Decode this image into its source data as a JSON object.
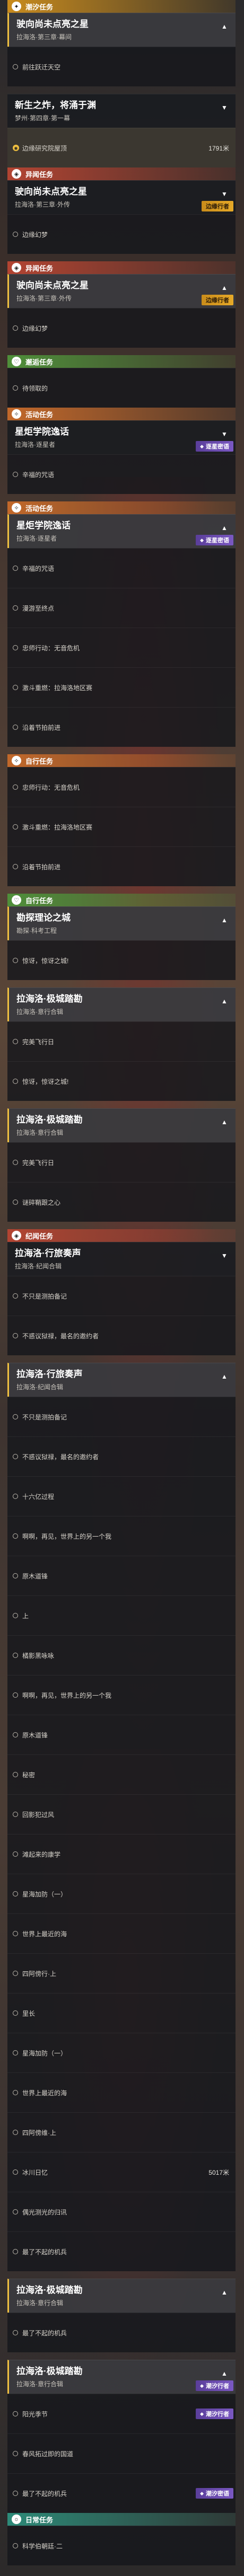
{
  "theme": {
    "trail": "#c88b1e",
    "rift": "#b34432",
    "event": "#c2682a",
    "companion": "#4f8f3a",
    "daily": "#2d8a78",
    "badge_gold": "#e6a928",
    "badge_purple": "#7a58c2"
  },
  "blocks": [
    {
      "type": "category",
      "style": "trail",
      "icon": "trail-icon",
      "label": "潮汐任务"
    },
    {
      "type": "quest",
      "title": "驶向尚未点亮之星",
      "sub": "拉海洛·第三章·幕间",
      "state": "expanded"
    },
    {
      "type": "objective",
      "text": "前往跃迁天空"
    },
    {
      "type": "spacer"
    },
    {
      "type": "quest",
      "title": "新生之炸，将涌于渊",
      "sub": "梦州·第四章·第一幕",
      "state": "collapsed"
    },
    {
      "type": "objective",
      "text": "边缘研究院屋顶",
      "dist": "1791米",
      "marker": "loc",
      "highlight": true
    },
    {
      "type": "category",
      "style": "rift",
      "icon": "rift-icon",
      "label": "异闻任务"
    },
    {
      "type": "quest",
      "title": "驶向尚未点亮之星",
      "sub": "拉海洛·第三章·外传",
      "badge": "边缘行者",
      "state": "collapsed"
    },
    {
      "type": "objective",
      "text": "边缘幻梦"
    },
    {
      "type": "spacer"
    },
    {
      "type": "category",
      "style": "rift",
      "icon": "rift-icon",
      "label": "异闻任务"
    },
    {
      "type": "quest",
      "title": "驶向尚未点亮之星",
      "sub": "拉海洛·第三章·外传",
      "badge": "边缘行者",
      "state": "expanded"
    },
    {
      "type": "objective",
      "text": "边缘幻梦"
    },
    {
      "type": "spacer"
    },
    {
      "type": "category",
      "style": "companion",
      "icon": "companion-icon",
      "label": "邂逅任务"
    },
    {
      "type": "objective",
      "text": "待领取的"
    },
    {
      "type": "category",
      "style": "event",
      "icon": "event-icon",
      "label": "活动任务"
    },
    {
      "type": "quest",
      "title": "星炬学院逸话",
      "sub": "拉海洛·逐星者",
      "badge": "逐星密语",
      "badge_style": "purple",
      "state": "collapsed"
    },
    {
      "type": "objective",
      "text": "辛福的咒语"
    },
    {
      "type": "spacer"
    },
    {
      "type": "category",
      "style": "event",
      "icon": "event-icon",
      "label": "活动任务"
    },
    {
      "type": "quest",
      "title": "星炬学院逸话",
      "sub": "拉海洛·逐星者",
      "badge": "逐星密语",
      "badge_style": "purple",
      "state": "expanded"
    },
    {
      "type": "objective",
      "text": "辛福的咒语"
    },
    {
      "type": "objective",
      "text": "漫游至终点"
    },
    {
      "type": "objective",
      "text": "忠师行动：无音危机"
    },
    {
      "type": "objective",
      "text": "激斗重燃：拉海洛地区赛"
    },
    {
      "type": "objective",
      "text": "沿着节拍前进"
    },
    {
      "type": "spacer"
    },
    {
      "type": "category",
      "style": "event",
      "icon": "event-icon",
      "label": "自行任务"
    },
    {
      "type": "objective",
      "text": "忠师行动：无音危机"
    },
    {
      "type": "objective",
      "text": "激斗重燃：拉海洛地区赛"
    },
    {
      "type": "objective",
      "text": "沿着节拍前进"
    },
    {
      "type": "spacer"
    },
    {
      "type": "category",
      "style": "companion",
      "icon": "companion-icon",
      "label": "自行任务"
    },
    {
      "type": "quest",
      "title": "勘探理论之城",
      "sub": "勘探·科考工程",
      "state": "expanded"
    },
    {
      "type": "objective",
      "text": "惊讶，惊讶之城!"
    },
    {
      "type": "spacer"
    },
    {
      "type": "quest",
      "title": "拉海洛·极城踏勘",
      "sub": "拉海洛·意行合辑",
      "state": "expanded"
    },
    {
      "type": "objective",
      "text": "完美飞行日"
    },
    {
      "type": "objective",
      "text": "惊讶，惊讶之城!"
    },
    {
      "type": "spacer"
    },
    {
      "type": "quest",
      "title": "拉海洛·极城踏勘",
      "sub": "拉海洛·意行合辑",
      "state": "expanded"
    },
    {
      "type": "objective",
      "text": "完美飞行日"
    },
    {
      "type": "objective",
      "text": "谜碎鞘跟之心"
    },
    {
      "type": "spacer"
    },
    {
      "type": "category",
      "style": "rift",
      "icon": "rift-icon",
      "label": "纪闻任务"
    },
    {
      "type": "quest",
      "title": "拉海洛·行旅奏声",
      "sub": "拉海洛·纪闻合辑",
      "state": "collapsed"
    },
    {
      "type": "objective",
      "text": "不只是测拍备记"
    },
    {
      "type": "objective",
      "text": "不惑议狱禄，最名的邀约者"
    },
    {
      "type": "spacer"
    },
    {
      "type": "quest",
      "title": "拉海洛·行旅奏声",
      "sub": "拉海洛·纪闻合辑",
      "state": "expanded"
    },
    {
      "type": "objective",
      "text": "不只是测拍备记"
    },
    {
      "type": "objective",
      "text": "不惑议狱禄，最名的邀约者"
    },
    {
      "type": "objective",
      "text": "十六亿过程"
    },
    {
      "type": "objective",
      "text": "啊啊，再见，世界上的另一个我"
    },
    {
      "type": "objective",
      "text": "原木道锋"
    },
    {
      "type": "objective",
      "text": "上"
    },
    {
      "type": "objective",
      "text": "橘影黑咏咏"
    },
    {
      "type": "objective",
      "text": "啊啊，再见，世界上的另一个我"
    },
    {
      "type": "objective",
      "text": "原木道锋"
    },
    {
      "type": "objective",
      "text": "秘密"
    },
    {
      "type": "objective",
      "text": "回影犯过风"
    },
    {
      "type": "objective",
      "text": "滩起来的康学"
    },
    {
      "type": "objective",
      "text": "星海加防（一）"
    },
    {
      "type": "objective",
      "text": "世界上最近的海"
    },
    {
      "type": "objective",
      "text": "四阿傍行·上"
    },
    {
      "type": "objective",
      "text": "里长"
    },
    {
      "type": "objective",
      "text": "星海加防（一）"
    },
    {
      "type": "objective",
      "text": "世界上最近的海"
    },
    {
      "type": "objective",
      "text": "四阿傍维·上"
    },
    {
      "type": "objective",
      "text": "冰川日忆",
      "dist": "5017米"
    },
    {
      "type": "objective",
      "text": "偶光测光的归讯"
    },
    {
      "type": "objective",
      "text": "最了不起的机兵"
    },
    {
      "type": "spacer"
    },
    {
      "type": "quest",
      "title": "拉海洛·极城踏勘",
      "sub": "拉海洛·意行合辑",
      "state": "expanded"
    },
    {
      "type": "objective",
      "text": "最了不起的机兵"
    },
    {
      "type": "spacer"
    },
    {
      "type": "quest",
      "title": "拉海洛·极城踏勘",
      "sub": "拉海洛·意行合辑",
      "badge": "潮汐行者",
      "badge_style": "purple",
      "state": "expanded"
    },
    {
      "type": "objective",
      "text": "阳光季节",
      "badge": "潮汐行者",
      "badge_style": "purple"
    },
    {
      "type": "objective",
      "text": "春风拓过即的国道"
    },
    {
      "type": "objective",
      "text": "最了不起的机兵",
      "badge": "潮汐密语",
      "badge_style": "purple"
    },
    {
      "type": "category",
      "style": "daily",
      "icon": "daily-icon",
      "label": "日常任务"
    },
    {
      "type": "objective",
      "text": "科学伯朝廷·二"
    }
  ]
}
